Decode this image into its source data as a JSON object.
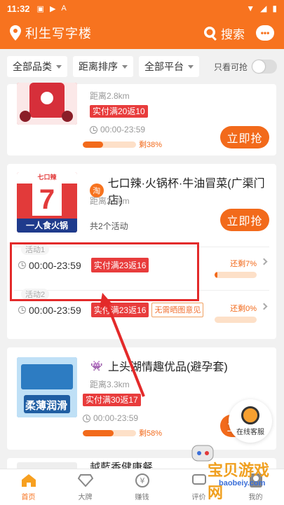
{
  "status_bar": {
    "time": "11:32"
  },
  "app_bar": {
    "location": "利生写字楼",
    "search_label": "搜索"
  },
  "filters": {
    "category": "全部品类",
    "sort": "距离排序",
    "platform": "全部平台",
    "only_available": "只看可抢",
    "only_available_on": false
  },
  "cards": [
    {
      "distance": "距离2.8km",
      "deal": "实付满20返10",
      "hours": "00:00-23:59",
      "remaining": "剩38%",
      "remaining_fraction": 0.38,
      "button": "立即抢"
    },
    {
      "platform_badge": "淘",
      "title": "七口辣·火锅杯·牛油冒菜(广渠门店)",
      "thumb_top": "七口辣",
      "thumb_num": "7",
      "thumb_bottom": "一人食火锅",
      "distance": "距离2.8km",
      "activity_count": "共2个活动",
      "button": "立即抢",
      "activities": [
        {
          "label": "活动1",
          "hours": "00:00-23:59",
          "deal": "实付满23返16",
          "note": "",
          "remaining": "还剩7%",
          "remaining_fraction": 0.07
        },
        {
          "label": "活动2",
          "hours": "00:00-23:59",
          "deal": "实付满23返16",
          "note": "无需晒图意见",
          "remaining": "还剩0%",
          "remaining_fraction": 0.0
        }
      ]
    },
    {
      "platform_badge": "👾",
      "title": "上头湖情趣优品(避孕套)",
      "thumb_text": "柔薄润滑",
      "distance": "距离3.3km",
      "deal": "实付满30返17",
      "hours": "00:00-23:59",
      "remaining": "剩58%",
      "remaining_fraction": 0.58,
      "button": "立即抢"
    },
    {
      "title": "越藍香健康餐"
    }
  ],
  "service": {
    "label": "在线客服"
  },
  "tabbar": [
    {
      "label": "首页",
      "icon": "home-icon",
      "active": true
    },
    {
      "label": "大牌",
      "icon": "diamond-icon",
      "active": false
    },
    {
      "label": "赚钱",
      "icon": "yen-icon",
      "active": false
    },
    {
      "label": "评价",
      "icon": "comment-icon",
      "active": false
    },
    {
      "label": "我的",
      "icon": "user-icon",
      "active": false
    }
  ],
  "watermark": {
    "text": "宝贝游戏网",
    "url": "baobeiy.com"
  },
  "colors": {
    "brand": "#f7731f",
    "deal_red": "#e83c3c",
    "annotation": "#e32a2a"
  }
}
